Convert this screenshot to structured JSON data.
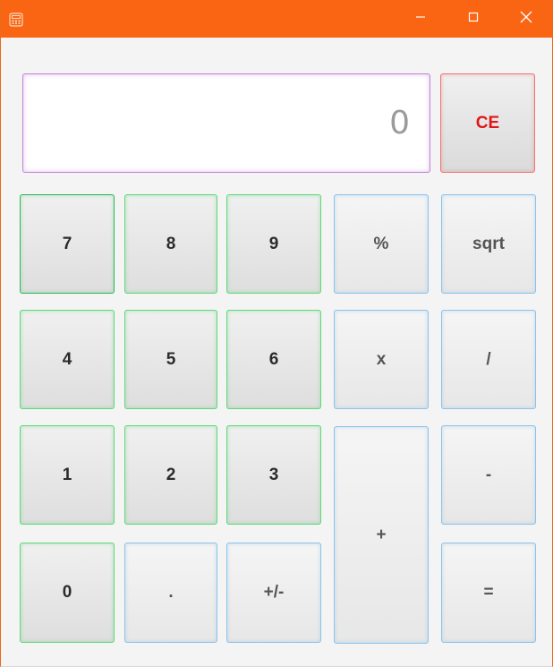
{
  "colors": {
    "titlebar": "#f96513",
    "number_key_border": "#5fd87a",
    "operator_key_border": "#8cc3ea",
    "clear_key_border": "#ef7575",
    "clear_key_text": "#e11717",
    "display_border": "#c283d6"
  },
  "titlebar": {
    "app_icon": "calculator-icon",
    "minimize_icon": "minimize-icon",
    "maximize_icon": "maximize-icon",
    "close_icon": "close-icon"
  },
  "display": {
    "value": "0"
  },
  "keys": {
    "ce": "CE",
    "seven": "7",
    "eight": "8",
    "nine": "9",
    "percent": "%",
    "sqrt": "sqrt",
    "four": "4",
    "five": "5",
    "six": "6",
    "multiply": "x",
    "divide": "/",
    "one": "1",
    "two": "2",
    "three": "3",
    "plus": "+",
    "minus": "-",
    "zero": "0",
    "decimal": ".",
    "negate": "+/-",
    "equals": "="
  }
}
